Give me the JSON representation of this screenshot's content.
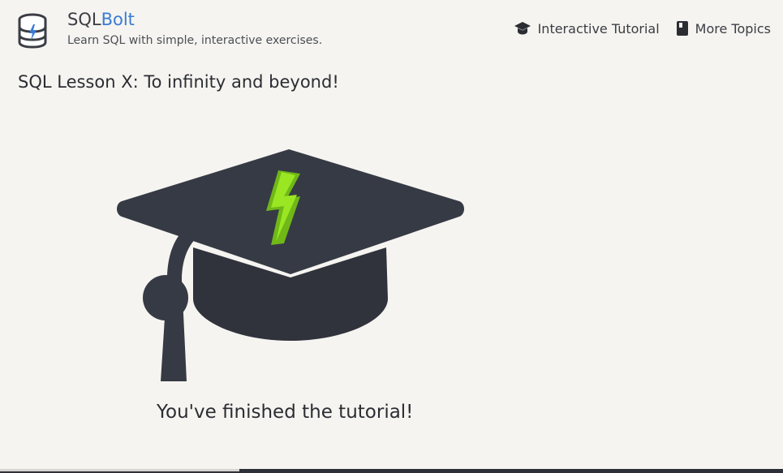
{
  "header": {
    "brand_prefix": "SQL",
    "brand_suffix": "Bolt",
    "tagline": "Learn SQL with simple, interactive exercises.",
    "logo_icon": "database-bolt-icon"
  },
  "nav": {
    "items": [
      {
        "label": "Interactive Tutorial",
        "icon": "graduation-cap-icon"
      },
      {
        "label": "More Topics",
        "icon": "book-icon"
      }
    ]
  },
  "lesson": {
    "title": "SQL Lesson X: To infinity and beyond!"
  },
  "completion": {
    "message": "You've finished the tutorial!",
    "illustration": "graduation-cap-bolt-icon"
  },
  "colors": {
    "brand_accent": "#3a7bd5",
    "cap_dark": "#363a44",
    "bolt_green": "#8ce019",
    "background": "#f5f4f0"
  }
}
